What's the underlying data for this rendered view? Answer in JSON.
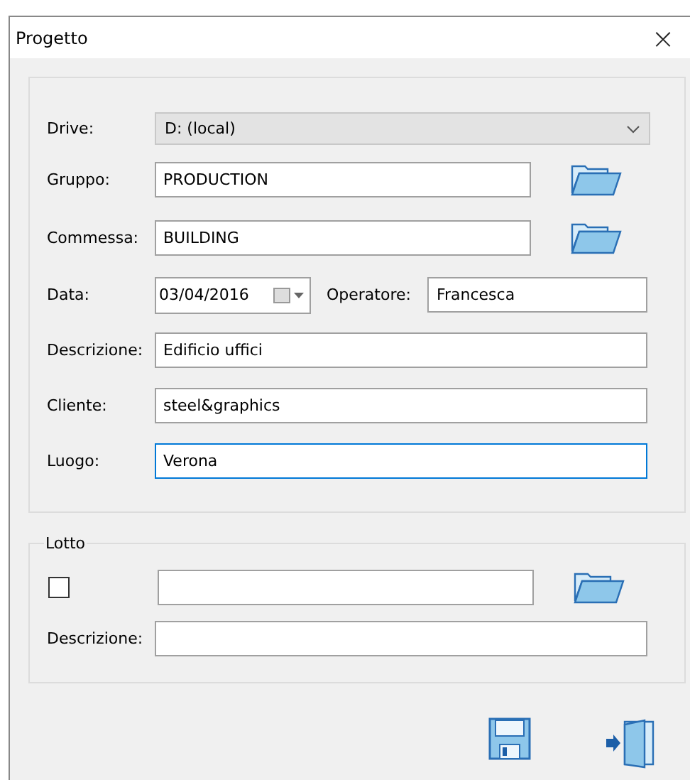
{
  "window": {
    "title": "Progetto",
    "close": "×"
  },
  "project": {
    "fields": [
      {
        "kind": "select",
        "label": "Drive:",
        "value": "D: (local)"
      },
      {
        "kind": "browse",
        "label": "Gruppo:",
        "value": "PRODUCTION",
        "focused": false
      },
      {
        "kind": "browse",
        "label": "Commessa:",
        "value": "BUILDING",
        "focused": false
      },
      {
        "kind": "date",
        "label": "Data:",
        "value": "03/04/2016",
        "extra_label": "Operatore:",
        "extra_value": "Francesca"
      },
      {
        "kind": "text",
        "label": "Descrizione:",
        "value": "Edificio uffici",
        "focused": false
      },
      {
        "kind": "text",
        "label": "Cliente:",
        "value": "steel&graphics",
        "focused": false
      },
      {
        "kind": "text",
        "label": "Luogo:",
        "value": "Verona",
        "focused": true
      }
    ]
  },
  "lotto": {
    "title": "Lotto",
    "checked": false,
    "description_label": "Descrizione:"
  }
}
